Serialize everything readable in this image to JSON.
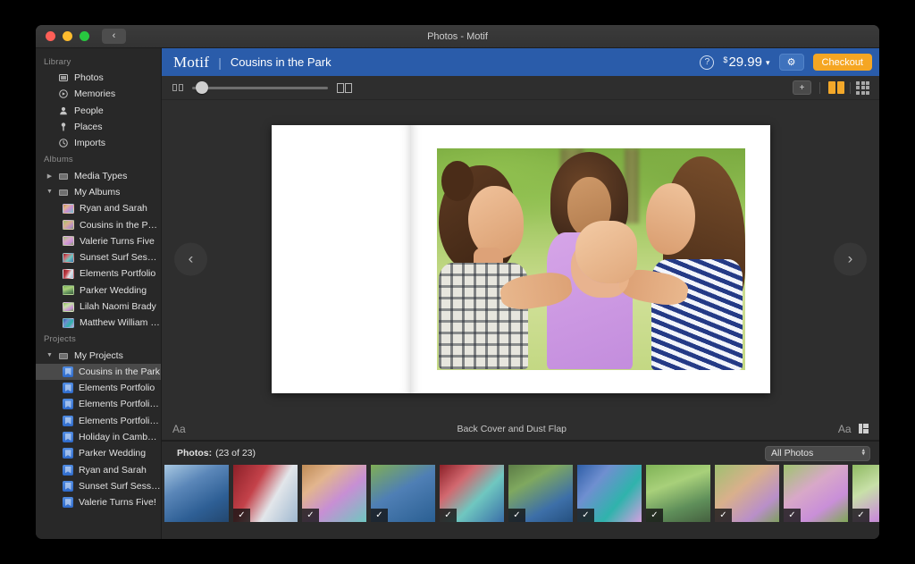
{
  "window": {
    "title": "Photos - Motif",
    "back_label": "‹",
    "traffic": {
      "close": "close-button",
      "minimize": "minimize-button",
      "zoom": "zoom-button"
    }
  },
  "sidebar": {
    "groups": [
      {
        "label": "Library",
        "items": [
          {
            "label": "Photos",
            "icon": "photos-icon"
          },
          {
            "label": "Memories",
            "icon": "memories-icon"
          },
          {
            "label": "People",
            "icon": "people-icon"
          },
          {
            "label": "Places",
            "icon": "places-icon"
          },
          {
            "label": "Imports",
            "icon": "imports-icon"
          }
        ]
      },
      {
        "label": "Albums",
        "items": [
          {
            "label": "Media Types",
            "icon": "folder-icon",
            "twisty": "▶"
          },
          {
            "label": "My Albums",
            "icon": "folder-icon",
            "twisty": "▼"
          },
          {
            "label": "Ryan and Sarah",
            "icon": "album-thumb",
            "indent": 2
          },
          {
            "label": "Cousins in the Park",
            "icon": "album-thumb",
            "indent": 2
          },
          {
            "label": "Valerie Turns Five",
            "icon": "album-thumb",
            "indent": 2
          },
          {
            "label": "Sunset Surf Session",
            "icon": "album-thumb",
            "indent": 2
          },
          {
            "label": "Elements Portfolio",
            "icon": "album-thumb",
            "indent": 2
          },
          {
            "label": "Parker Wedding",
            "icon": "album-thumb",
            "indent": 2
          },
          {
            "label": "Lilah Naomi Brady",
            "icon": "album-thumb",
            "indent": 2
          },
          {
            "label": "Matthew William Ja…",
            "icon": "album-thumb",
            "indent": 2
          }
        ]
      },
      {
        "label": "Projects",
        "items": [
          {
            "label": "My Projects",
            "icon": "folder-icon",
            "twisty": "▼"
          },
          {
            "label": "Cousins in the Park",
            "icon": "project-icon",
            "indent": 2,
            "selected": true
          },
          {
            "label": "Elements Portfolio",
            "icon": "project-icon",
            "indent": 2
          },
          {
            "label": "Elements Portfolio…",
            "icon": "project-icon",
            "indent": 2
          },
          {
            "label": "Elements Portfolio…",
            "icon": "project-icon",
            "indent": 2
          },
          {
            "label": "Holiday in Cambodia",
            "icon": "project-icon",
            "indent": 2
          },
          {
            "label": "Parker Wedding",
            "icon": "project-icon",
            "indent": 2
          },
          {
            "label": "Ryan and Sarah",
            "icon": "project-icon",
            "indent": 2
          },
          {
            "label": "Sunset Surf Session",
            "icon": "project-icon",
            "indent": 2
          },
          {
            "label": "Valerie Turns Five!",
            "icon": "project-icon",
            "indent": 2
          }
        ]
      }
    ]
  },
  "bluebar": {
    "brand": "Motif",
    "divider": "|",
    "project_title": "Cousins in the Park",
    "help_label": "?",
    "price_currency": "$",
    "price_amount": "29.99",
    "price_chevron": "⌵",
    "gear_label": "⚙",
    "checkout_label": "Checkout",
    "accent_blue": "#2a5caa",
    "accent_orange": "#f5a623"
  },
  "controlbar": {
    "zoom_out_icon": "single-page-icon",
    "zoom_in_icon": "double-page-icon",
    "slider_value": "0",
    "add_page_label": "+",
    "view_two_page": "two-page-view",
    "view_grid": "grid-view"
  },
  "canvas": {
    "prev_label": "‹",
    "next_label": "›",
    "caption": "Back Cover and Dust Flap",
    "text_left_label": "Aa",
    "text_right_label": "Aa"
  },
  "browser": {
    "count_label": "Photos:",
    "count_value": "(23 of 23)",
    "filter_value": "All Photos",
    "stepper_up": "▴",
    "stepper_down": "▾",
    "check_glyph": "✓",
    "thumbnails": [
      {
        "name": "boy-on-slide",
        "cls": "p-playA",
        "checked": false,
        "selected": true
      },
      {
        "name": "red-slide-tube",
        "cls": "p-slide",
        "checked": true,
        "selected": false
      },
      {
        "name": "three-girls-playground",
        "cls": "p-group1",
        "checked": true,
        "selected": false
      },
      {
        "name": "boy-blue-shirt",
        "cls": "p-boyblue",
        "checked": true,
        "selected": false
      },
      {
        "name": "kids-red-slide",
        "cls": "p-groupred",
        "checked": true,
        "selected": false
      },
      {
        "name": "boy-closeup-group",
        "cls": "p-boyclose",
        "checked": true,
        "selected": false
      },
      {
        "name": "girl-climbing-frame",
        "cls": "p-climb",
        "checked": true,
        "selected": false
      },
      {
        "name": "girls-with-bikes",
        "cls": "p-bike",
        "checked": true,
        "selected": false
      },
      {
        "name": "three-girls-bubbles",
        "cls": "p-three",
        "checked": true,
        "selected": false
      },
      {
        "name": "girl-blowing-bubbles",
        "cls": "p-bubble1",
        "checked": true,
        "selected": false
      },
      {
        "name": "girl-bubbles-park",
        "cls": "p-bubble2",
        "checked": true,
        "selected": false
      }
    ]
  }
}
